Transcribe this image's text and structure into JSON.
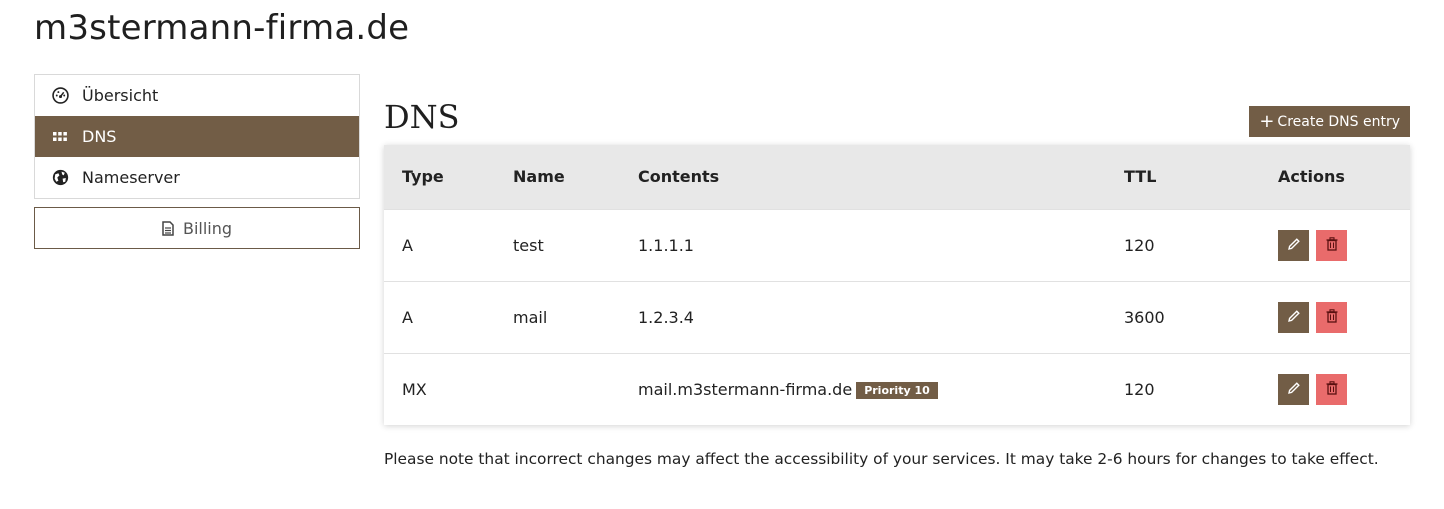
{
  "site": {
    "title": "m3stermann-firma.de"
  },
  "sidebar": {
    "items": [
      {
        "label": "Übersicht",
        "icon": "dashboard-icon",
        "active": false
      },
      {
        "label": "DNS",
        "icon": "grid-icon",
        "active": true
      },
      {
        "label": "Nameserver",
        "icon": "globe-icon",
        "active": false
      }
    ],
    "billing": {
      "label": "Billing",
      "icon": "document-icon"
    }
  },
  "dns": {
    "title": "DNS",
    "create_label": "Create DNS entry",
    "columns": [
      "Type",
      "Name",
      "Contents",
      "TTL",
      "Actions"
    ],
    "rows": [
      {
        "type": "A",
        "name": "test",
        "contents": "1.1.1.1",
        "badge": "",
        "ttl": "120"
      },
      {
        "type": "A",
        "name": "mail",
        "contents": "1.2.3.4",
        "badge": "",
        "ttl": "3600"
      },
      {
        "type": "MX",
        "name": "",
        "contents": "mail.m3stermann-firma.de",
        "badge": "Priority 10",
        "ttl": "120"
      }
    ],
    "note": "Please note that incorrect changes may affect the accessibility of your services. It may take 2-6 hours for changes to take effect."
  },
  "colors": {
    "brand": "#725d46",
    "danger": "#e96b6b",
    "header_bg": "#e8e8e8"
  }
}
